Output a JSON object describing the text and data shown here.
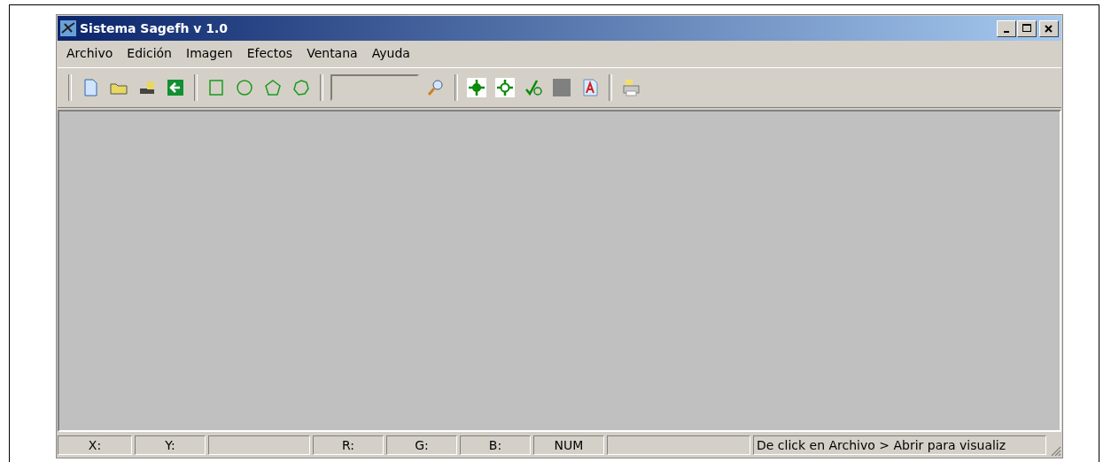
{
  "window": {
    "title": "Sistema Sagefh v 1.0"
  },
  "menu": [
    "Archivo",
    "Edición",
    "Imagen",
    "Efectos",
    "Ventana",
    "Ayuda"
  ],
  "status_bar": [
    "X:",
    "Y:",
    "R:",
    "G:",
    "B:",
    "NUM",
    "De click en Archivo > Abrir para visualiz"
  ]
}
